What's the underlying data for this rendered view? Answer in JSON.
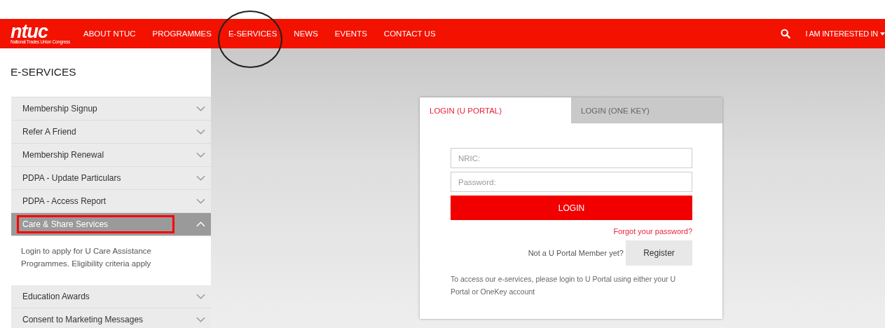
{
  "logo": {
    "mark": "ntuc",
    "tagline": "National Trades Union Congress"
  },
  "nav": {
    "items": [
      {
        "label": "ABOUT NTUC",
        "circled": false
      },
      {
        "label": "PROGRAMMES",
        "circled": false
      },
      {
        "label": "E-SERVICES",
        "circled": true
      },
      {
        "label": "NEWS",
        "circled": false
      },
      {
        "label": "EVENTS",
        "circled": false
      },
      {
        "label": "CONTACT US",
        "circled": false
      }
    ],
    "menu": "I AM INTERESTED IN"
  },
  "sidebar": {
    "title": "E-SERVICES",
    "items": [
      {
        "label": "Membership Signup",
        "expanded": false,
        "highlighted": false
      },
      {
        "label": "Refer A Friend",
        "expanded": false,
        "highlighted": false
      },
      {
        "label": "Membership Renewal",
        "expanded": false,
        "highlighted": false
      },
      {
        "label": "PDPA - Update Particulars",
        "expanded": false,
        "highlighted": false
      },
      {
        "label": "PDPA - Access Report",
        "expanded": false,
        "highlighted": false
      },
      {
        "label": "Care & Share Services",
        "expanded": true,
        "highlighted": true,
        "body": "Login to apply for U Care Assistance Programmes. Eligibility criteria apply"
      },
      {
        "label": "Education Awards",
        "expanded": false,
        "highlighted": false
      },
      {
        "label": "Consent to Marketing Messages",
        "expanded": false,
        "highlighted": false
      }
    ]
  },
  "login": {
    "tabs": [
      {
        "label": "LOGIN (U PORTAL)",
        "selected": true
      },
      {
        "label": "LOGIN (ONE KEY)",
        "selected": false
      }
    ],
    "nric": {
      "placeholder": "NRIC:"
    },
    "password": {
      "placeholder": "Password:"
    },
    "button": "LOGIN",
    "forgot": "Forgot your password?",
    "member_prompt": "Not a U Portal Member yet?",
    "register": "Register",
    "note": "To access our e-services, please login to U Portal using either your U Portal or OneKey account"
  }
}
